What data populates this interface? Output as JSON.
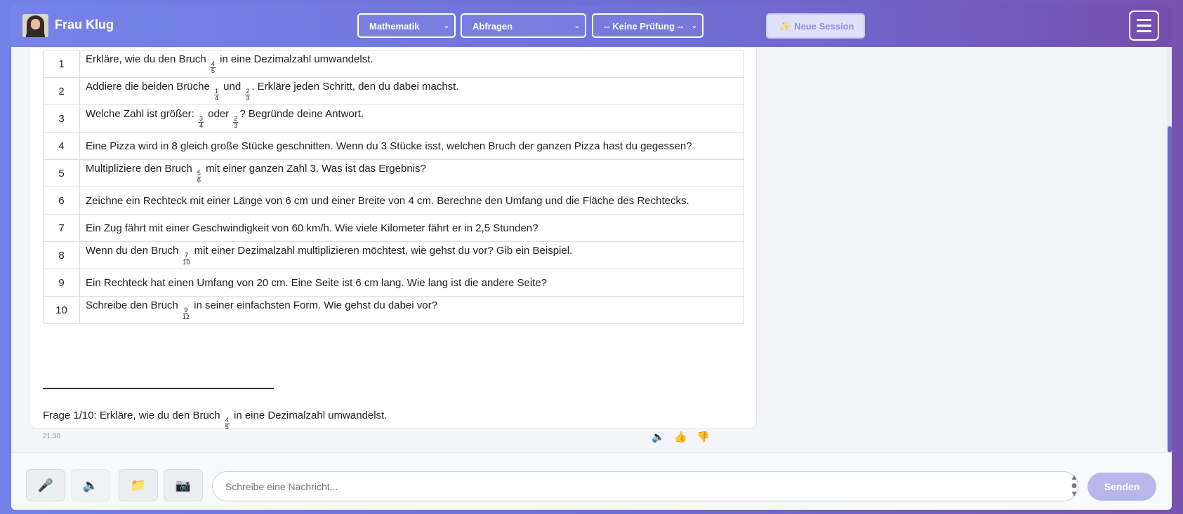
{
  "header": {
    "title": "Frau Klug",
    "subject": "Mathematik",
    "mode": "Abfragen",
    "exam": "-- Keine Prüfung --",
    "new_session": "Neue Session"
  },
  "questions": [
    {
      "num": "1",
      "parts": [
        "Erkläre, wie du den Bruch ",
        {
          "n": "4",
          "d": "5"
        },
        " in eine Dezimalzahl umwandelst."
      ]
    },
    {
      "num": "2",
      "parts": [
        "Addiere die beiden Brüche ",
        {
          "n": "1",
          "d": "4"
        },
        " und ",
        {
          "n": "2",
          "d": "3"
        },
        ". Erkläre jeden Schritt, den du dabei machst."
      ]
    },
    {
      "num": "3",
      "parts": [
        "Welche Zahl ist größer: ",
        {
          "n": "3",
          "d": "4"
        },
        " oder ",
        {
          "n": "2",
          "d": "3"
        },
        "? Begründe deine Antwort."
      ]
    },
    {
      "num": "4",
      "parts": [
        "Eine Pizza wird in 8 gleich große Stücke geschnitten. Wenn du 3 Stücke isst, welchen Bruch der ganzen Pizza hast du gegessen?"
      ]
    },
    {
      "num": "5",
      "parts": [
        "Multipliziere den Bruch ",
        {
          "n": "5",
          "d": "6"
        },
        " mit einer ganzen Zahl 3. Was ist das Ergebnis?"
      ]
    },
    {
      "num": "6",
      "parts": [
        "Zeichne ein Rechteck mit einer Länge von 6 cm und einer Breite von 4 cm. Berechne den Umfang und die Fläche des Rechtecks."
      ]
    },
    {
      "num": "7",
      "parts": [
        "Ein Zug fährt mit einer Geschwindigkeit von 60 km/h. Wie viele Kilometer fährt er in 2,5 Stunden?"
      ]
    },
    {
      "num": "8",
      "parts": [
        "Wenn du den Bruch ",
        {
          "n": "7",
          "d": "10"
        },
        " mit einer Dezimalzahl multiplizieren möchtest, wie gehst du vor? Gib ein Beispiel."
      ]
    },
    {
      "num": "9",
      "parts": [
        "Ein Rechteck hat einen Umfang von 20 cm. Eine Seite ist 6 cm lang. Wie lang ist die andere Seite?"
      ]
    },
    {
      "num": "10",
      "parts": [
        "Schreibe den Bruch ",
        {
          "n": "9",
          "d": "12"
        },
        " in seiner einfachsten Form. Wie gehst du dabei vor?"
      ]
    }
  ],
  "current": {
    "prefix": "Frage 1/10: Erkläre, wie du den Bruch ",
    "frac_n": "4",
    "frac_d": "5",
    "suffix": " in eine Dezimalzahl umwandelst."
  },
  "message_time": "21:30",
  "composer": {
    "placeholder": "Schreibe eine Nachricht...",
    "send_label": "Senden"
  },
  "icons": [
    "microphone-icon",
    "speaker-icon",
    "folder-icon",
    "camera-icon",
    "thumbs-up-icon",
    "thumbs-down-icon",
    "menu-icon",
    "sparkle-icon"
  ]
}
